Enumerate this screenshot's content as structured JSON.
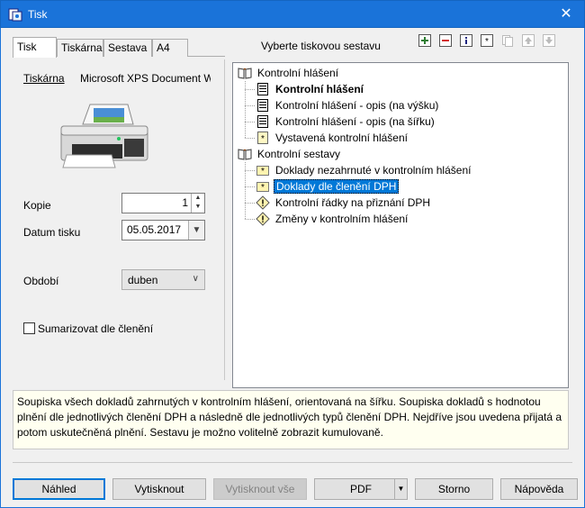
{
  "window": {
    "title": "Tisk",
    "close_glyph": "✕"
  },
  "tabs": [
    {
      "label": "Tisk",
      "active": true
    },
    {
      "label": "Tiskárna",
      "active": false
    },
    {
      "label": "Sestava",
      "active": false
    },
    {
      "label": "A4",
      "active": false
    }
  ],
  "printer": {
    "label": "Tiskárna",
    "name": "Microsoft XPS Document W"
  },
  "copies": {
    "label": "Kopie",
    "value": "1"
  },
  "print_date": {
    "label": "Datum tisku",
    "value": "05.05.2017"
  },
  "period": {
    "label": "Období",
    "value": "duben"
  },
  "summarize": {
    "label": "Sumarizovat dle členění",
    "checked": false
  },
  "report_header": "Vyberte tiskovou sestavu",
  "toolbar_icons": [
    "add-icon",
    "remove-icon",
    "info-icon",
    "star-icon",
    "copy-icon",
    "move-up-icon",
    "move-down-icon"
  ],
  "tree": {
    "groups": [
      {
        "label": "Kontrolní hlášení",
        "items": [
          {
            "label": "Kontrolní hlášení",
            "bold": true,
            "icon": "document-icon"
          },
          {
            "label": "Kontrolní hlášení - opis (na výšku)",
            "bold": false,
            "icon": "document-icon"
          },
          {
            "label": "Kontrolní hlášení - opis (na šířku)",
            "bold": false,
            "icon": "document-icon"
          },
          {
            "label": "Vystavená kontrolní hlášení",
            "bold": false,
            "icon": "star-document-icon"
          }
        ]
      },
      {
        "label": "Kontrolní sestavy",
        "items": [
          {
            "label": "Doklady nezahrnuté v kontrolním hlášení",
            "bold": false,
            "icon": "star-folder-icon"
          },
          {
            "label": "Doklady dle členění DPH",
            "bold": false,
            "icon": "star-folder-icon",
            "selected": true
          },
          {
            "label": "Kontrolní řádky na přiznání DPH",
            "bold": false,
            "icon": "warning-icon"
          },
          {
            "label": "Změny v kontrolním hlášení",
            "bold": false,
            "icon": "warning-icon"
          }
        ]
      }
    ]
  },
  "description": "Soupiska všech dokladů zahrnutých v kontrolním hlášení, orientovaná na šířku. Soupiska dokladů s hodnotou plnění dle jednotlivých členění DPH a následně dle jednotlivých typů členění DPH. Nejdříve jsou uvedena přijatá a potom uskutečněná plnění. Sestavu je možno volitelně zobrazit kumulovaně.",
  "buttons": {
    "preview": "Náhled",
    "print": "Vytisknout",
    "print_all": "Vytisknout vše",
    "pdf": "PDF",
    "cancel": "Storno",
    "help": "Nápověda"
  }
}
